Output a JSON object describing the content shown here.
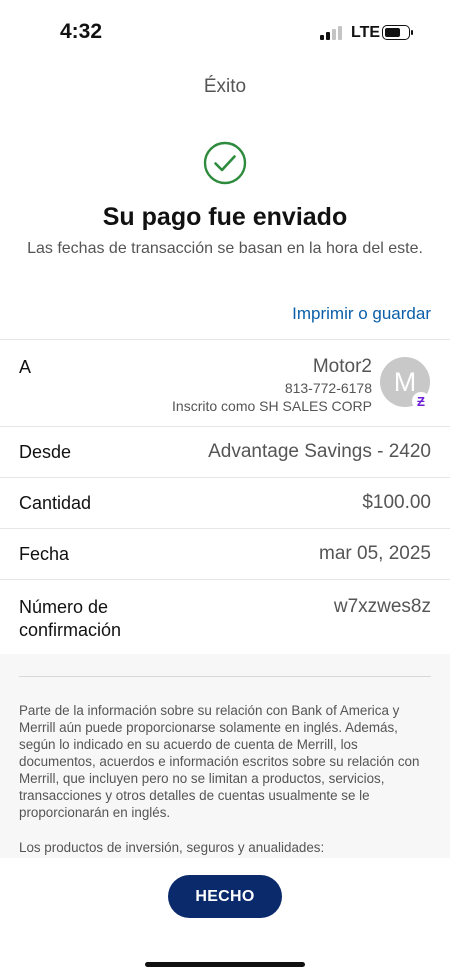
{
  "status_bar": {
    "time": "4:32",
    "network": "LTE",
    "signal_bars_active": 2,
    "signal_bars_total": 4,
    "battery_level": 0.7
  },
  "header": {
    "title": "Éxito"
  },
  "confirmation": {
    "icon": "check-circle-icon",
    "headline": "Su pago fue enviado",
    "subline": "Las fechas de transacción se basan en la hora del este.",
    "print_link": "Imprimir o guardar"
  },
  "details": {
    "to": {
      "label": "A",
      "name": "Motor2",
      "phone": "813-772-6178",
      "enrolled": "Inscrito como SH SALES CORP",
      "avatar_initial": "M",
      "badge_icon": "zelle-icon",
      "badge_glyph": "Ƶ"
    },
    "from": {
      "label": "Desde",
      "value": "Advantage Savings - 2420"
    },
    "amount": {
      "label": "Cantidad",
      "value": "$100.00"
    },
    "date": {
      "label": "Fecha",
      "value": "mar 05, 2025"
    },
    "confirmation_number": {
      "label": "Número de confirmación",
      "value": "w7xzwes8z"
    }
  },
  "disclosure": {
    "paragraph1": "Parte de la información sobre su relación con Bank of America y Merrill aún puede proporcionarse solamente en inglés. Además, según lo indicado en su acuerdo de cuenta de Merrill, los documentos, acuerdos e información escritos sobre su relación con Merrill, que incluyen pero no se limitan a productos, servicios, transacciones y otros detalles de cuentas usualmente se le proporcionarán en inglés.",
    "paragraph2": "Los productos de inversión, seguros y anualidades:"
  },
  "actions": {
    "done_label": "HECHO"
  },
  "colors": {
    "accent_link": "#0a5fa8",
    "success_green": "#2e8b3d",
    "button_navy": "#0b2a6b",
    "zelle_purple": "#6d1ed4"
  }
}
